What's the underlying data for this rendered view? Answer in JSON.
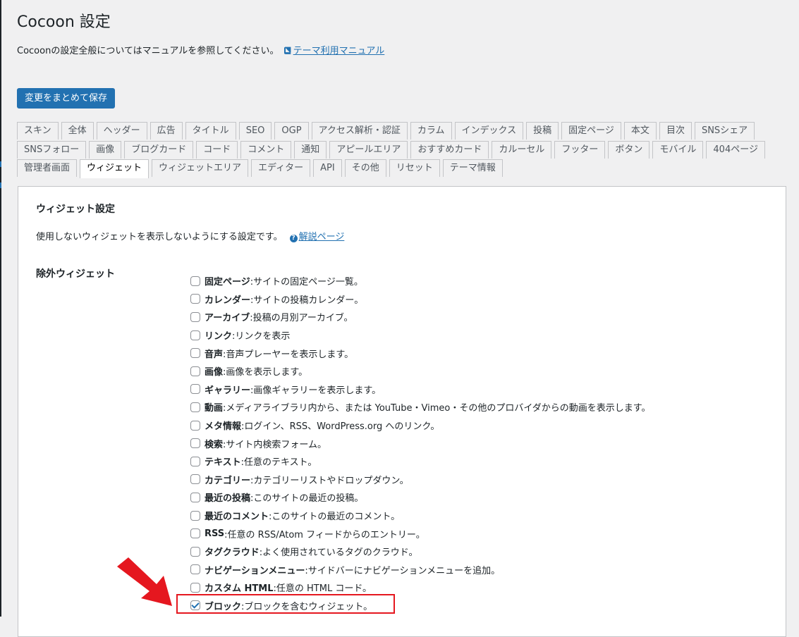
{
  "header": {
    "title": "Cocoon 設定",
    "intro_text": "Cocoonの設定全般についてはマニュアルを参照してください。",
    "manual_link": "テーマ利用マニュアル",
    "save_button": "変更をまとめて保存"
  },
  "tabs": {
    "row1": [
      "スキン",
      "全体",
      "ヘッダー",
      "広告",
      "タイトル",
      "SEO",
      "OGP",
      "アクセス解析・認証",
      "カラム",
      "インデックス",
      "投稿",
      "固定ページ",
      "本文",
      "目次",
      "SNSシェア"
    ],
    "row2": [
      "SNSフォロー",
      "画像",
      "ブログカード",
      "コード",
      "コメント",
      "通知",
      "アピールエリア",
      "おすすめカード",
      "カルーセル",
      "フッター",
      "ボタン",
      "モバイル",
      "404ページ"
    ],
    "row3": [
      "管理者画面",
      "ウィジェット",
      "ウィジェットエリア",
      "エディター",
      "API",
      "その他",
      "リセット",
      "テーマ情報"
    ],
    "active": "ウィジェット"
  },
  "panel": {
    "title": "ウィジェット設定",
    "description": "使用しないウィジェットを表示しないようにする設定です。",
    "help_link": "解説ページ",
    "field_label": "除外ウィジェット",
    "options": [
      {
        "name": "固定ページ",
        "desc": ":サイトの固定ページ一覧。",
        "checked": false
      },
      {
        "name": "カレンダー",
        "desc": ":サイトの投稿カレンダー。",
        "checked": false
      },
      {
        "name": "アーカイブ",
        "desc": ":投稿の月別アーカイブ。",
        "checked": false
      },
      {
        "name": "リンク",
        "desc": ":リンクを表示",
        "checked": false
      },
      {
        "name": "音声",
        "desc": ":音声プレーヤーを表示します。",
        "checked": false
      },
      {
        "name": "画像",
        "desc": ":画像を表示します。",
        "checked": false
      },
      {
        "name": "ギャラリー",
        "desc": ":画像ギャラリーを表示します。",
        "checked": false
      },
      {
        "name": "動画",
        "desc": ":メディアライブラリ内から、または YouTube・Vimeo・その他のプロバイダからの動画を表示します。",
        "checked": false
      },
      {
        "name": "メタ情報",
        "desc": ":ログイン、RSS、WordPress.org へのリンク。",
        "checked": false
      },
      {
        "name": "検索",
        "desc": ":サイト内検索フォーム。",
        "checked": false
      },
      {
        "name": "テキスト",
        "desc": ":任意のテキスト。",
        "checked": false
      },
      {
        "name": "カテゴリー",
        "desc": ":カテゴリーリストやドロップダウン。",
        "checked": false
      },
      {
        "name": "最近の投稿",
        "desc": ":このサイトの最近の投稿。",
        "checked": false
      },
      {
        "name": "最近のコメント",
        "desc": ":このサイトの最近のコメント。",
        "checked": false
      },
      {
        "name": "RSS",
        "desc": ":任意の RSS/Atom フィードからのエントリー。",
        "checked": false
      },
      {
        "name": "タグクラウド",
        "desc": ":よく使用されているタグのクラウド。",
        "checked": false
      },
      {
        "name": "ナビゲーションメニュー",
        "desc": ":サイドバーにナビゲーションメニューを追加。",
        "checked": false
      },
      {
        "name": "カスタム HTML",
        "desc": ":任意の HTML コード。",
        "checked": false
      },
      {
        "name": "ブロック",
        "desc": ":ブロックを含むウィジェット。",
        "checked": true,
        "highlighted": true
      }
    ]
  },
  "colors": {
    "accent": "#2271b1",
    "highlight": "#e5171f",
    "background": "#f0f0f1"
  }
}
